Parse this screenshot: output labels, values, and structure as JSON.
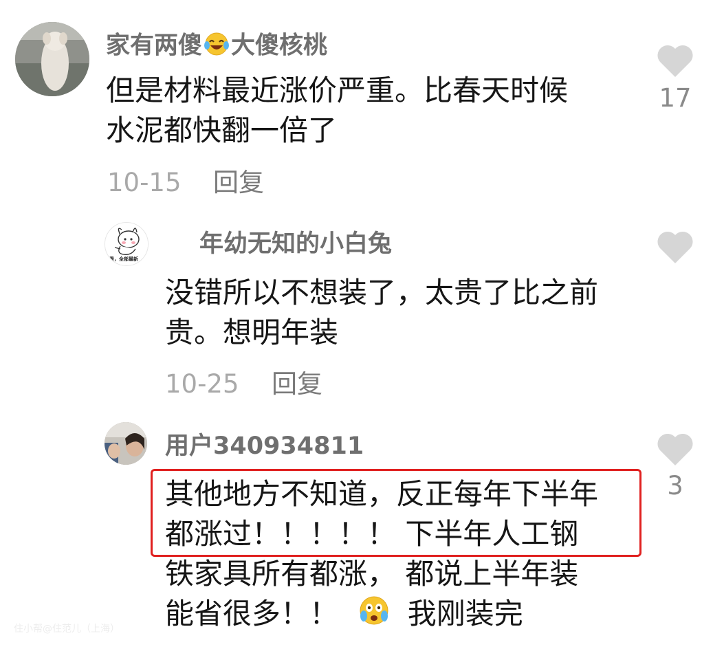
{
  "comments": [
    {
      "username": "家有两傻",
      "username_suffix": "大傻核桃",
      "username_emoji": "laughing-tears-emoji",
      "lines": [
        "但是材料最近涨价严重。比春天时候",
        "水泥都快翻一倍了"
      ],
      "date": "10-15",
      "reply_label": "回复",
      "likes": "17"
    },
    {
      "username": "年幼无知的小白兔",
      "avatar_caption": "看，全部最新",
      "lines": [
        "没错所以不想装了，太贵了比之前",
        "贵。想明年装"
      ],
      "date": "10-25",
      "reply_label": "回复",
      "likes": ""
    },
    {
      "username": "用户340934811",
      "lines": [
        "其他地方不知道，反正每年下半年",
        "都涨过！！！！！  下半年人工钢",
        "铁家具所有都涨， 都说上半年装",
        "能省很多！！"
      ],
      "last_line_suffix": "我刚装完",
      "inline_emoji": "tearful-laugh-emoji",
      "likes": "3"
    }
  ],
  "watermark": "住小帮@住范儿（上海）",
  "colors": {
    "highlight_border": "#e0201f",
    "username": "#6f6f6f",
    "meta": "#a9a9a9",
    "heart": "#d6d6d6"
  }
}
